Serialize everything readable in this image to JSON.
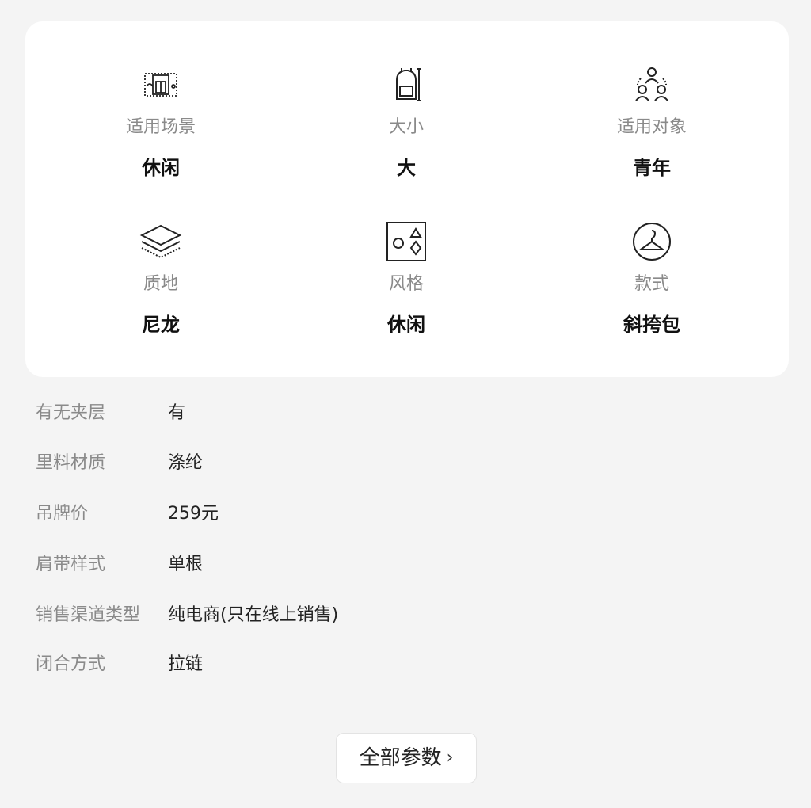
{
  "features": [
    {
      "icon": "scene-icon",
      "label": "适用场景",
      "value": "休闲"
    },
    {
      "icon": "backpack-icon",
      "label": "大小",
      "value": "大"
    },
    {
      "icon": "people-icon",
      "label": "适用对象",
      "value": "青年"
    },
    {
      "icon": "layers-icon",
      "label": "质地",
      "value": "尼龙"
    },
    {
      "icon": "shapes-icon",
      "label": "风格",
      "value": "休闲"
    },
    {
      "icon": "hanger-icon",
      "label": "款式",
      "value": "斜挎包"
    }
  ],
  "specs": [
    {
      "key": "有无夹层",
      "value": "有"
    },
    {
      "key": "里料材质",
      "value": "涤纶"
    },
    {
      "key": "吊牌价",
      "value": "259元"
    },
    {
      "key": "肩带样式",
      "value": "单根"
    },
    {
      "key": "销售渠道类型",
      "value": "纯电商(只在线上销售)"
    },
    {
      "key": "闭合方式",
      "value": "拉链"
    }
  ],
  "all_params_button": {
    "label": "全部参数",
    "chevron": "›"
  }
}
